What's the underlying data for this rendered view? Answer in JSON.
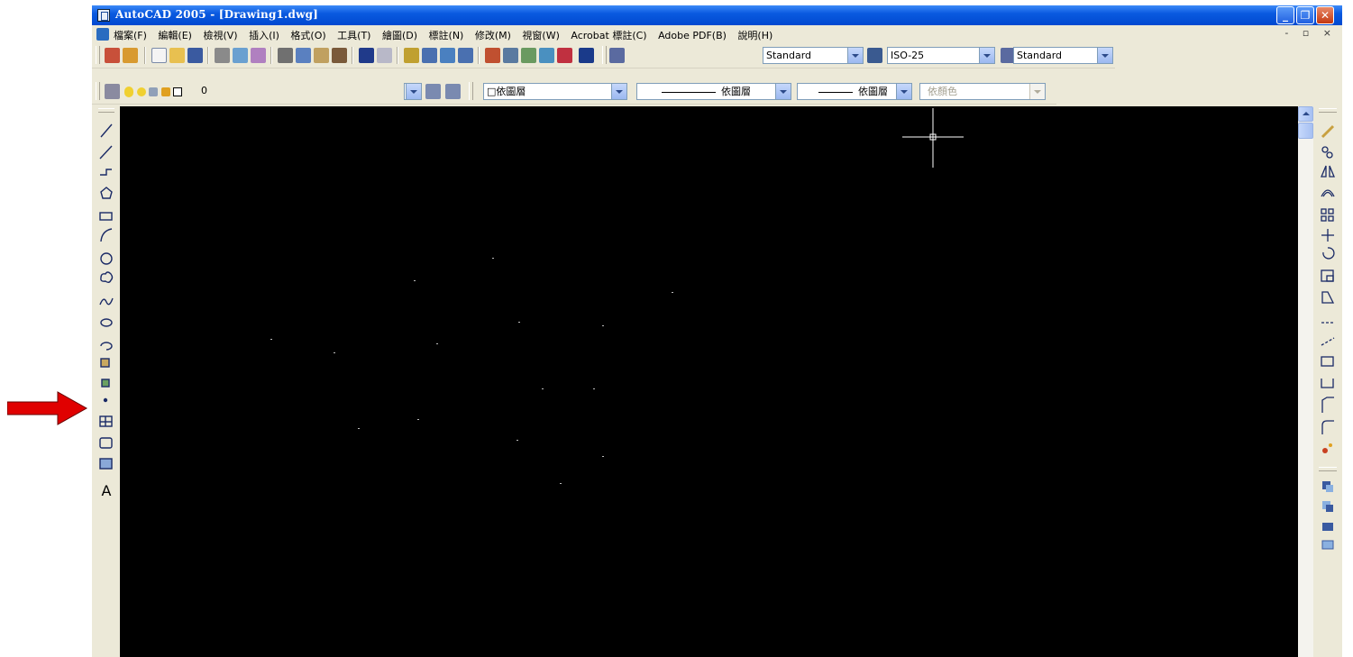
{
  "window": {
    "title": "AutoCAD 2005 - [Drawing1.dwg]",
    "controls": [
      "minimize",
      "restore",
      "close"
    ]
  },
  "menubar": {
    "items": [
      "檔案(F)",
      "編輯(E)",
      "檢視(V)",
      "插入(I)",
      "格式(O)",
      "工具(T)",
      "繪圖(D)",
      "標註(N)",
      "修改(M)",
      "視窗(W)",
      "Acrobat 標註(C)",
      "Adobe PDF(B)",
      "說明(H)"
    ],
    "mdi_controls": "- ▫ ×"
  },
  "standard_toolbar": {
    "text_style": "Standard",
    "dim_style": "ISO-25",
    "table_style": "Standard"
  },
  "layers_toolbar": {
    "current_layer": "0",
    "color": "□依圖層",
    "linetype": "依圖層",
    "lineweight": "依圖層",
    "plot_style": "依顏色"
  },
  "draw_toolbar": {
    "icons": [
      "line-icon",
      "construction-line-icon",
      "polyline-icon",
      "polygon-icon",
      "rectangle-icon",
      "arc-icon",
      "circle-icon",
      "revision-cloud-icon",
      "spline-icon",
      "ellipse-icon",
      "ellipse-arc-icon",
      "insert-block-icon",
      "make-block-icon",
      "point-icon",
      "hatch-icon",
      "region-icon",
      "table-icon",
      "multiline-text-icon"
    ],
    "text_tool_label": "A"
  },
  "modify_toolbar": {
    "icons": [
      "erase-icon",
      "copy-icon",
      "mirror-icon",
      "offset-icon",
      "array-icon",
      "move-icon",
      "rotate-icon",
      "scale-icon",
      "stretch-icon",
      "trim-icon",
      "extend-icon",
      "break-at-point-icon",
      "break-icon",
      "chamfer-icon",
      "fillet-icon",
      "explode-icon"
    ],
    "draworder_icons": [
      "bring-to-front-icon",
      "send-to-back-icon",
      "bring-above-icon",
      "send-under-icon"
    ]
  },
  "colors": {
    "titlebar": "#0a5ae0",
    "canvas": "#000000",
    "chrome": "#ece9d8",
    "annotation_arrow": "#e00000"
  }
}
